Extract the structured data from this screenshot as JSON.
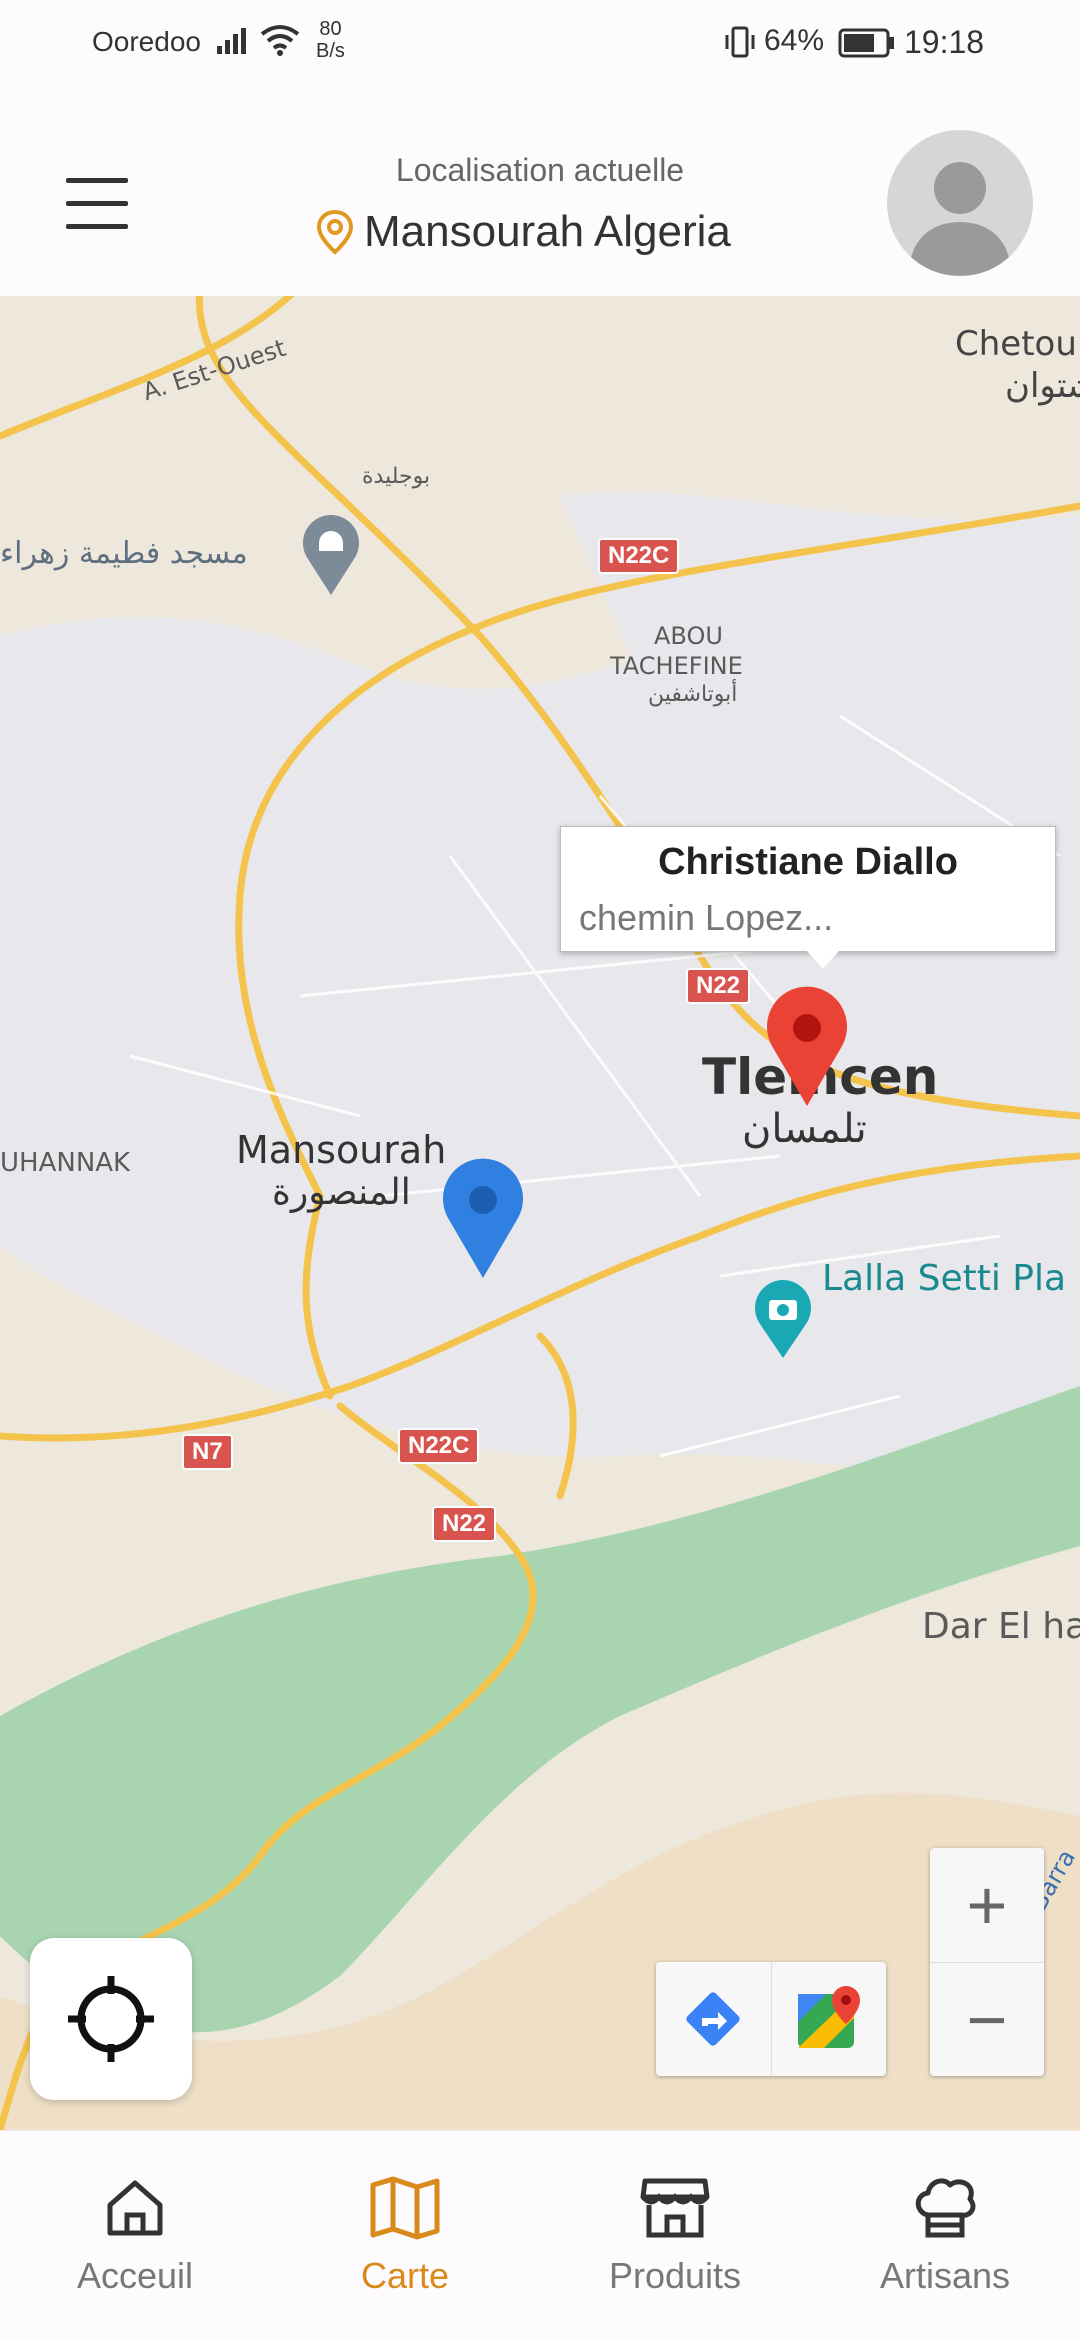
{
  "status_bar": {
    "carrier": "Ooredoo",
    "net_speed_value": "80",
    "net_speed_unit": "B/s",
    "battery": "64%",
    "time": "19:18"
  },
  "header": {
    "location_label": "Localisation actuelle",
    "location_name": "Mansourah Algeria",
    "location_icon": "location-pin-icon",
    "accent_color": "#e0981f"
  },
  "map": {
    "labels": {
      "a_est_ouest": "A. Est-Ouest",
      "boujlida": "بوجليدة",
      "mosque": "مسجد فطيمة زهراء",
      "abou_tachfine_1": "ABOU",
      "abou_tachfine_2": "TACHEFINE",
      "abou_tachfine_ar": "أبوتاشفين",
      "chetouane": "Chetou",
      "chetouane_ar": "شتوان",
      "tlemcen": "Tlemcen",
      "tlemcen_ar": "تلمسان",
      "mansourah": "Mansourah",
      "mansourah_ar": "المنصورة",
      "ouhannak": "UHANNAK",
      "lalla_setti": "Lalla Setti Pla",
      "dar_el": "Dar El ha",
      "barrage": "Barra"
    },
    "roads": {
      "n22c_top": "N22C",
      "n22_mid": "N22",
      "n7": "N7",
      "n22c_bottom": "N22C",
      "n22_bottom": "N22"
    },
    "info_window": {
      "title": "Christiane Diallo",
      "snippet": "chemin Lopez..."
    },
    "markers": {
      "user_color": "#2f80e0",
      "artisan_color": "#ea4335"
    },
    "controls": {
      "zoom_in": "+",
      "zoom_out": "−"
    }
  },
  "bottom_nav": {
    "items": [
      {
        "label": "Acceuil",
        "icon": "home-icon",
        "active": false
      },
      {
        "label": "Carte",
        "icon": "map-icon",
        "active": true
      },
      {
        "label": "Produits",
        "icon": "store-icon",
        "active": false
      },
      {
        "label": "Artisans",
        "icon": "chef-hat-icon",
        "active": false
      }
    ],
    "active_color": "#d98a1b"
  }
}
